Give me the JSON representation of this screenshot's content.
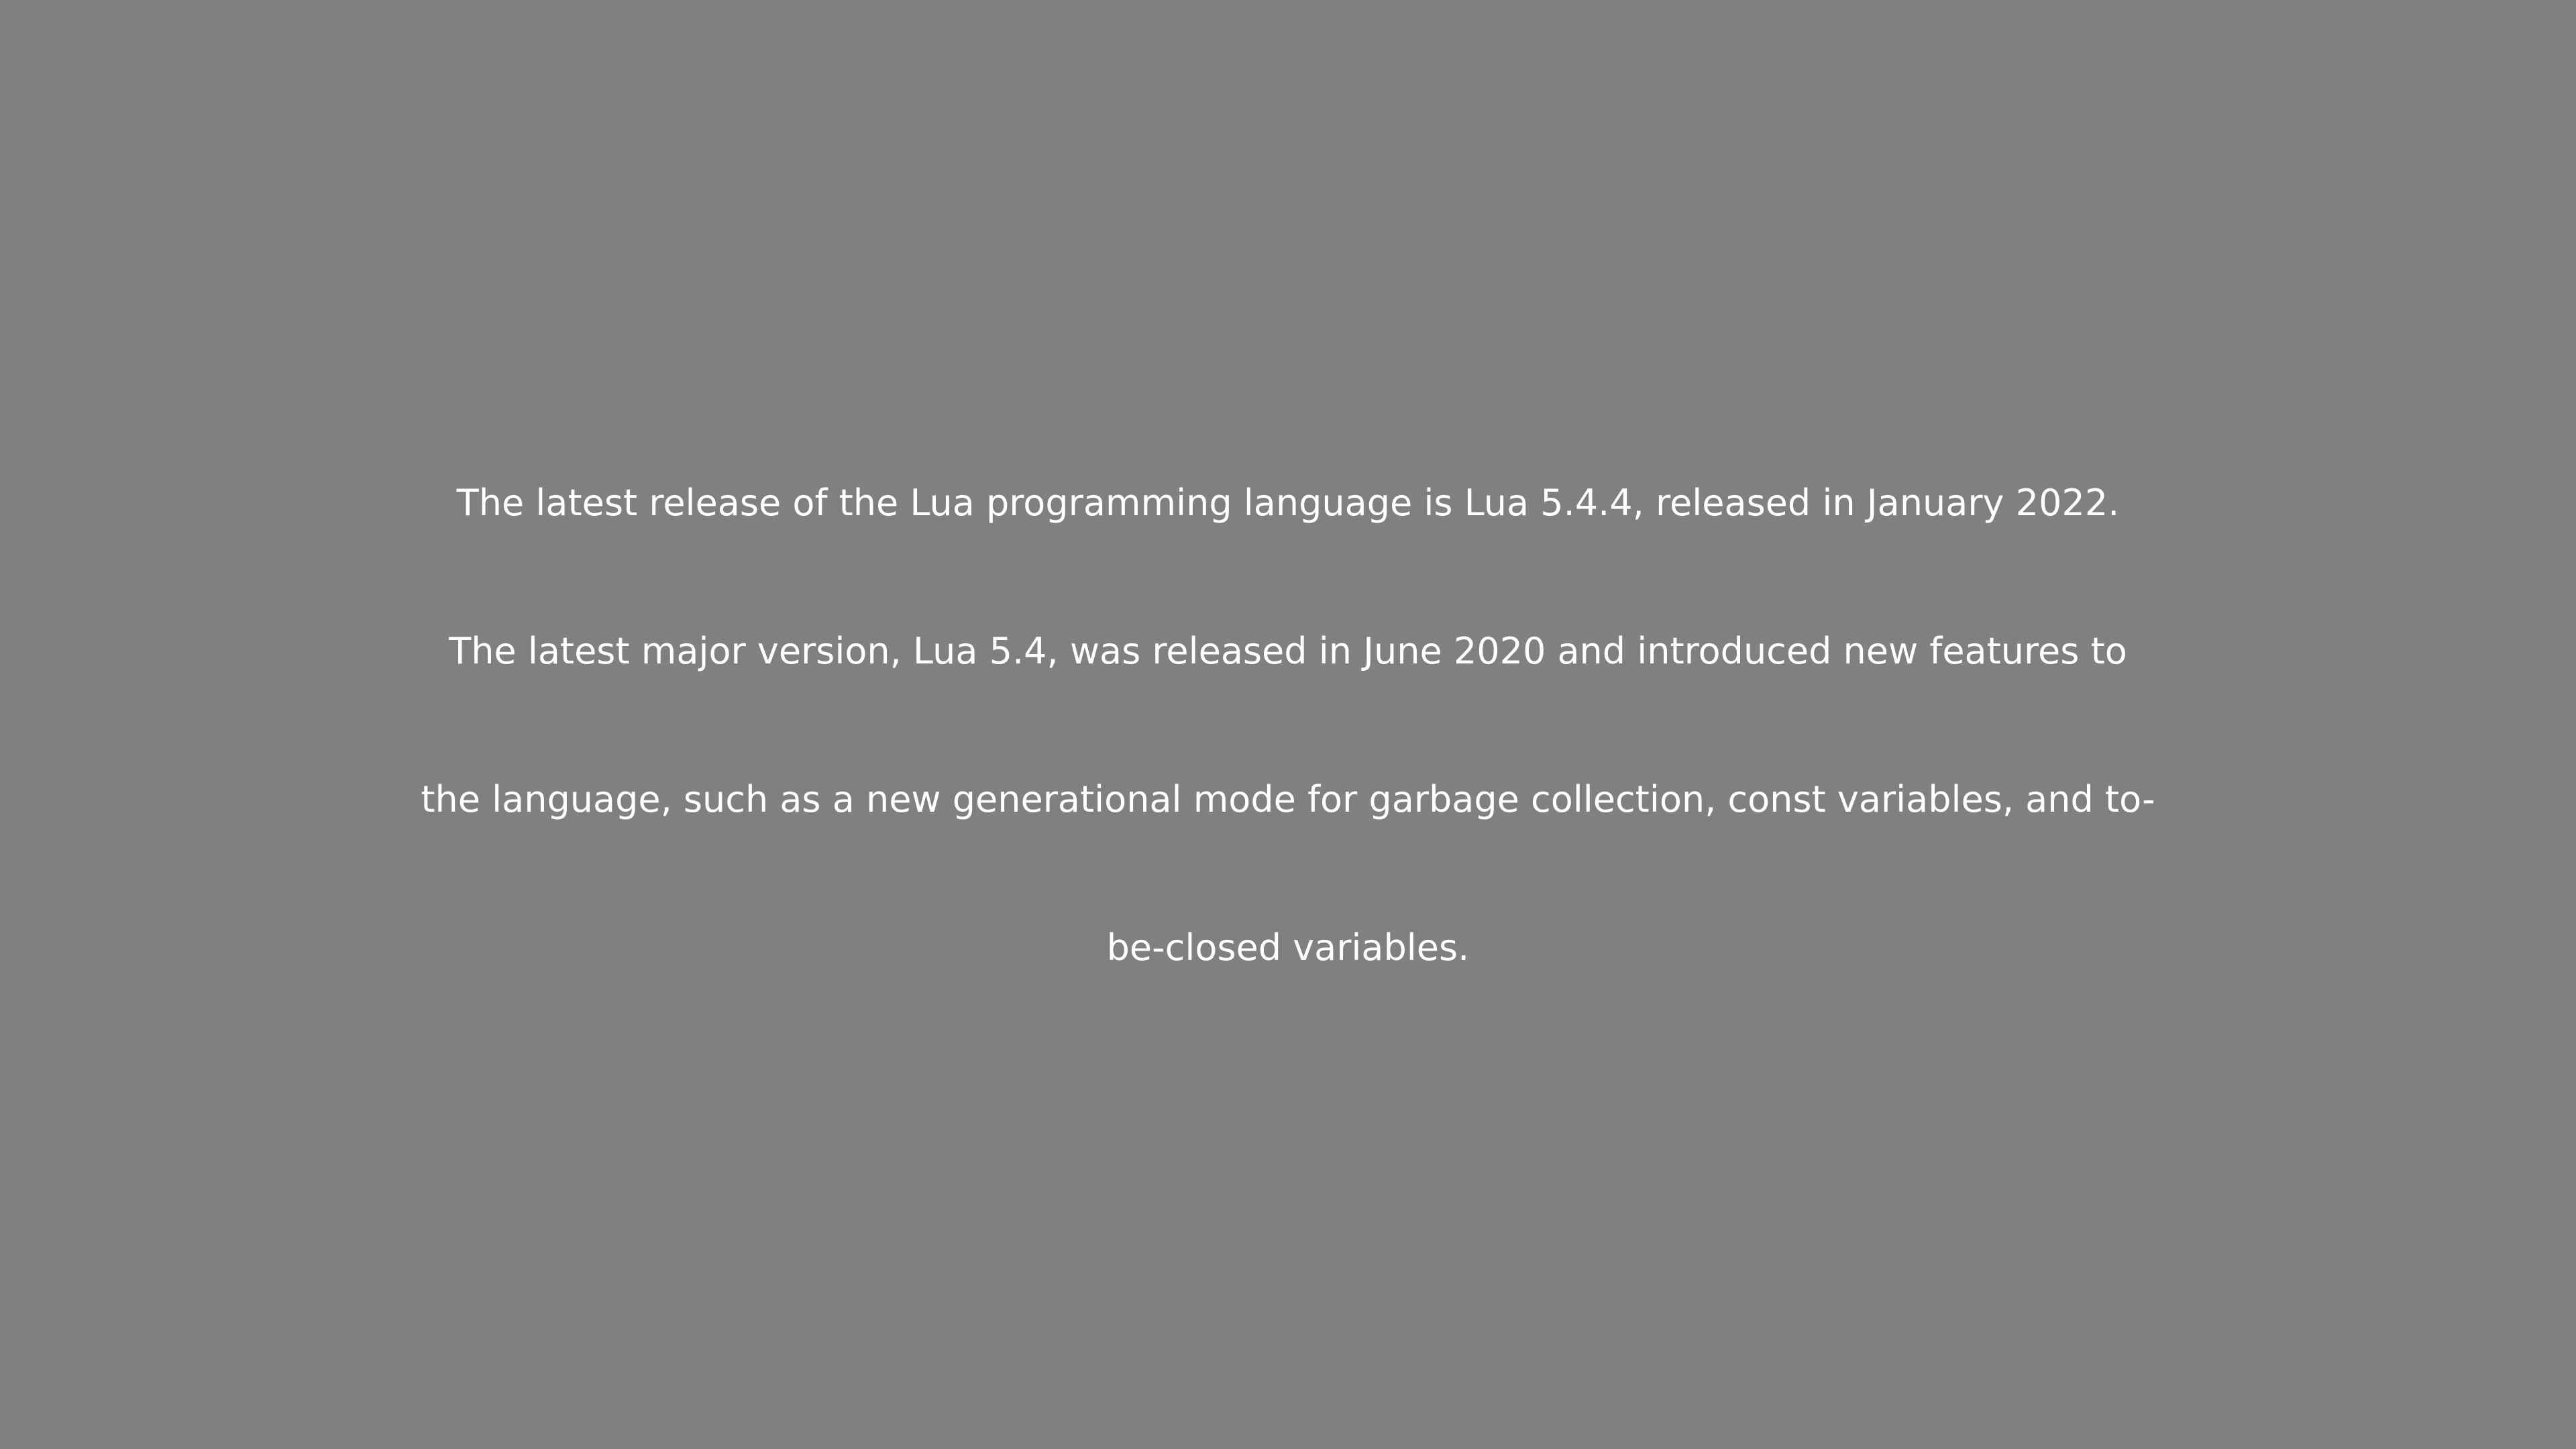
{
  "content": {
    "lines": [
      "The latest release of the Lua programming language is Lua 5.4.4, released in January 2022.",
      "The latest major version, Lua 5.4, was released in June 2020 and introduced new features to",
      "the language, such as a new generational mode for garbage collection, const variables, and to-",
      "be-closed variables."
    ]
  },
  "colors": {
    "background": "#808080",
    "text": "#ffffff"
  }
}
